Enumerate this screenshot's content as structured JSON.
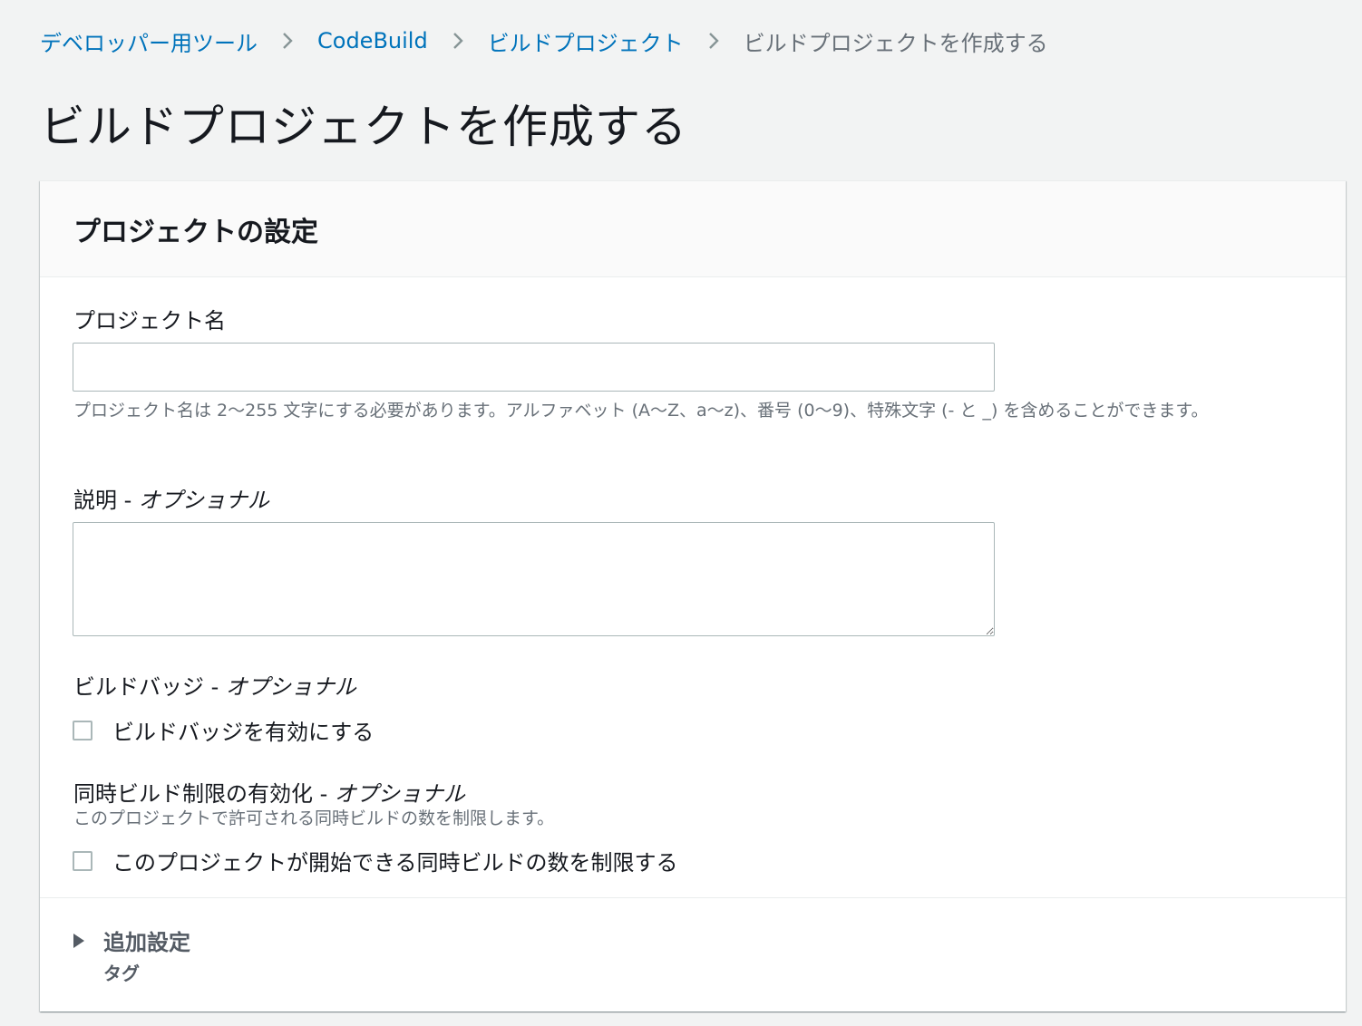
{
  "breadcrumb": {
    "items": [
      {
        "label": "デベロッパー用ツール"
      },
      {
        "label": "CodeBuild"
      },
      {
        "label": "ビルドプロジェクト"
      }
    ],
    "current": "ビルドプロジェクトを作成する"
  },
  "page": {
    "title": "ビルドプロジェクトを作成する"
  },
  "project_settings": {
    "title": "プロジェクトの設定",
    "project_name": {
      "label": "プロジェクト名",
      "value": "",
      "hint": "プロジェクト名は 2〜255 文字にする必要があります。アルファベット (A〜Z、a〜z)、番号 (0〜9)、特殊文字 (- と _) を含めることができます。"
    },
    "description": {
      "label": "説明 - ",
      "optional": "オプショナル",
      "value": ""
    },
    "build_badge": {
      "label": "ビルドバッジ - ",
      "optional": "オプショナル",
      "checkbox_label": "ビルドバッジを有効にする",
      "checked": false
    },
    "concurrent_build_limit": {
      "label": "同時ビルド制限の有効化 - ",
      "optional": "オプショナル",
      "hint": "このプロジェクトで許可される同時ビルドの数を制限します。",
      "checkbox_label": "このプロジェクトが開始できる同時ビルドの数を制限する",
      "checked": false
    },
    "additional_settings": {
      "label": "追加設定",
      "sub_label": "タグ",
      "expanded": false
    }
  },
  "colors": {
    "link": "#0073bb",
    "background": "#f2f3f3",
    "text": "#16191f",
    "muted": "#687078",
    "border": "#aab7b8"
  }
}
